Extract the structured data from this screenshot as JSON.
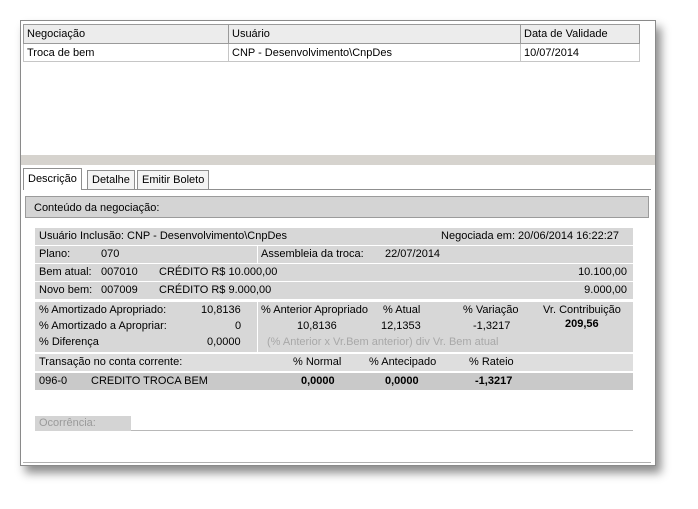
{
  "grid": {
    "columns": [
      "Negociação",
      "Usuário",
      "Data de Validade"
    ],
    "rows": [
      [
        "Troca de bem",
        "CNP - Desenvolvimento\\CnpDes",
        "10/07/2014"
      ]
    ]
  },
  "tabs": [
    "Descrição",
    "Detalhe",
    "Emitir Boleto"
  ],
  "active_tab": "Descrição",
  "section_title": "Conteúdo da negociação:",
  "usuario_inclusao": "Usuário Inclusão: CNP - Desenvolvimento\\CnpDes",
  "negociada_em": "Negociada em: 20/06/2014 16:22:27",
  "plano": {
    "label": "Plano:",
    "value": "070"
  },
  "assembleia": {
    "label": "Assembleia da troca:",
    "value": "22/07/2014"
  },
  "bem_atual": {
    "label": "Bem atual:",
    "code": "007010",
    "credit": "CRÉDITO R$ 10.000,00",
    "value": "10.100,00"
  },
  "novo_bem": {
    "label": "Novo bem:",
    "code": "007009",
    "credit": "CRÉDITO R$ 9.000,00",
    "value": "9.000,00"
  },
  "amortizado_apropriado": {
    "label": "% Amortizado Apropriado:",
    "value": "10,8136"
  },
  "amortizado_a_apropriar": {
    "label": "% Amortizado a Apropriar:",
    "value": "0"
  },
  "diferenca": {
    "label": "% Diferença",
    "value": "0,0000"
  },
  "anterior_apropriado": {
    "label": "% Anterior Apropriado",
    "value": "10,8136"
  },
  "atual": {
    "label": "% Atual",
    "value": "12,1353"
  },
  "variacao": {
    "label": "% Variação",
    "value": "-1,3217"
  },
  "vr_contribuicao": {
    "label": "Vr. Contribuição",
    "value": "209,56"
  },
  "formula_note": "(% Anterior x Vr.Bem anterior) div Vr. Bem atual",
  "transacao_header": {
    "label": "Transação no conta corrente:",
    "normal": "% Normal",
    "antecipado": "% Antecipado",
    "rateio": "% Rateio"
  },
  "transacao_row": {
    "code": "096-0",
    "description": "CREDITO TROCA BEM",
    "normal": "0,0000",
    "antecipado": "0,0000",
    "rateio": "-1,3217"
  },
  "ocorrencia_label": "Ocorrência:"
}
